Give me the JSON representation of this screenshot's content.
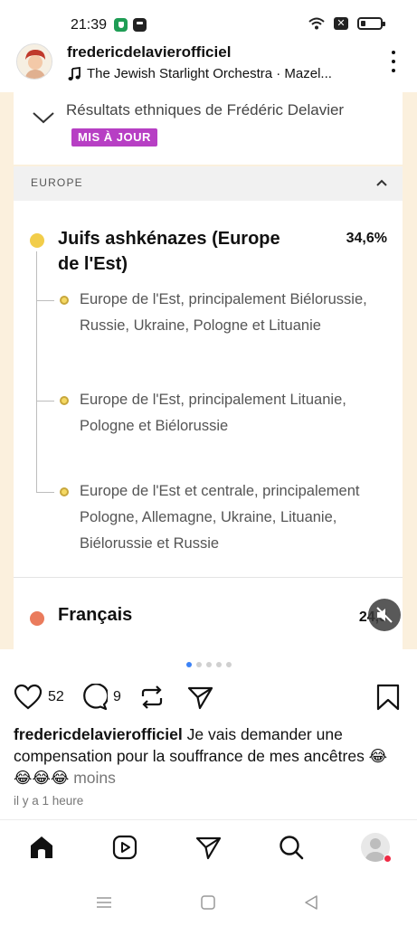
{
  "status_bar": {
    "time": "21:39",
    "icons": [
      "shield-app-icon",
      "message-app-icon",
      "wifi-icon",
      "sim-blocked-icon",
      "battery-icon"
    ]
  },
  "post": {
    "username": "fredericdelavierofficiel",
    "music": "The Jewish Starlight Orchestra · Mazel...",
    "media": {
      "results_title": "Résultats ethniques de Frédéric Delavier",
      "badge": "MIS À JOUR",
      "section_label": "EUROPE",
      "main_group": {
        "name": "Juifs ashkénazes (Europe de l'Est)",
        "percent": "34,6%",
        "color": "#f2cd4a",
        "sub_items": [
          "Europe de l'Est, principalement Biélorussie, Russie, Ukraine, Pologne et Lituanie",
          "Europe de l'Est, principalement Lituanie, Pologne et Biélorussie",
          "Europe de l'Est et centrale, principalement Pologne, Allemagne, Ukraine, Lituanie, Biélorussie et Russie"
        ]
      },
      "second_group": {
        "name": "Français",
        "percent": "24,3",
        "color": "#ea7b5c"
      },
      "carousel": {
        "count": 5,
        "active": 1
      }
    },
    "likes": "52",
    "comments": "9",
    "caption": {
      "author": "fredericdelavierofficiel",
      "text": "Je vais demander une compensation pour la souffrance de mes ancêtres 😂😂😂😂",
      "more": "moins"
    },
    "time_ago": "il y a 1 heure"
  },
  "bottom_nav": {
    "items": [
      "home-icon",
      "reels-icon",
      "send-icon",
      "search-icon",
      "profile-icon"
    ]
  },
  "system_nav": [
    "recents-icon",
    "home-square-icon",
    "back-icon"
  ]
}
